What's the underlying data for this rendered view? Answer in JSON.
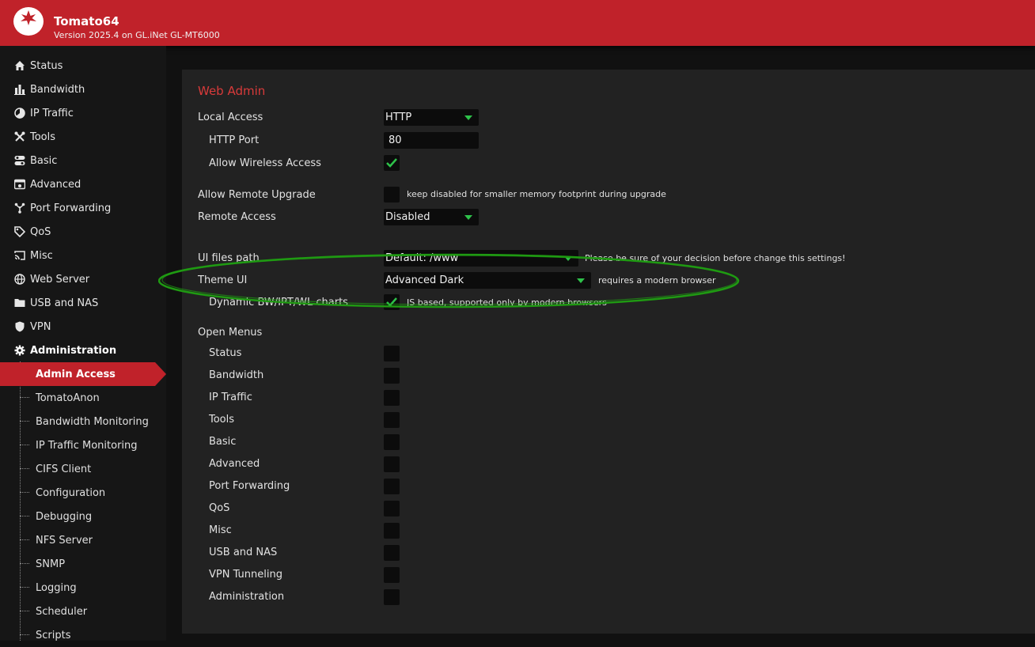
{
  "header": {
    "app_title": "Tomato64",
    "version": "Version 2025.4 on GL.iNet GL-MT6000"
  },
  "sidebar": {
    "items": [
      {
        "label": "Status",
        "icon": "home-icon"
      },
      {
        "label": "Bandwidth",
        "icon": "bar-chart-icon"
      },
      {
        "label": "IP Traffic",
        "icon": "pie-chart-icon"
      },
      {
        "label": "Tools",
        "icon": "tools-icon"
      },
      {
        "label": "Basic",
        "icon": "toggle-icon"
      },
      {
        "label": "Advanced",
        "icon": "advanced-icon"
      },
      {
        "label": "Port Forwarding",
        "icon": "network-icon"
      },
      {
        "label": "QoS",
        "icon": "tag-icon"
      },
      {
        "label": "Misc",
        "icon": "cast-icon"
      },
      {
        "label": "Web Server",
        "icon": "globe-icon"
      },
      {
        "label": "USB and NAS",
        "icon": "folder-icon"
      },
      {
        "label": "VPN",
        "icon": "shield-icon"
      },
      {
        "label": "Administration",
        "icon": "gear-icon"
      }
    ],
    "admin_subitems": [
      "Admin Access",
      "TomatoAnon",
      "Bandwidth Monitoring",
      "IP Traffic Monitoring",
      "CIFS Client",
      "Configuration",
      "Debugging",
      "NFS Server",
      "SNMP",
      "Logging",
      "Scheduler",
      "Scripts"
    ]
  },
  "main": {
    "section_title": "Web Admin",
    "local_access": {
      "label": "Local Access",
      "value": "HTTP"
    },
    "http_port": {
      "label": "HTTP Port",
      "value": "80"
    },
    "allow_wireless": {
      "label": "Allow Wireless Access",
      "checked": true
    },
    "allow_remote_upgrade": {
      "label": "Allow Remote Upgrade",
      "checked": false,
      "note": "keep disabled for smaller memory footprint during upgrade"
    },
    "remote_access": {
      "label": "Remote Access",
      "value": "Disabled"
    },
    "ui_files_path": {
      "label": "UI files path",
      "value": "Default: /www",
      "note": "Please be sure of your decision before change this settings!"
    },
    "theme_ui": {
      "label": "Theme UI",
      "value": "Advanced Dark",
      "note": "requires a modern browser"
    },
    "dynamic_charts": {
      "label": "Dynamic BW/IPT/WL charts",
      "checked": true,
      "note": "JS based, supported only by modern browsers"
    },
    "open_menus": {
      "label": "Open Menus",
      "items": [
        "Status",
        "Bandwidth",
        "IP Traffic",
        "Tools",
        "Basic",
        "Advanced",
        "Port Forwarding",
        "QoS",
        "Misc",
        "USB and NAS",
        "VPN Tunneling",
        "Administration"
      ]
    }
  },
  "colors": {
    "brand_red": "#c0222a",
    "accent_green": "#2ec24a",
    "annotation_green": "#1f9a12"
  }
}
